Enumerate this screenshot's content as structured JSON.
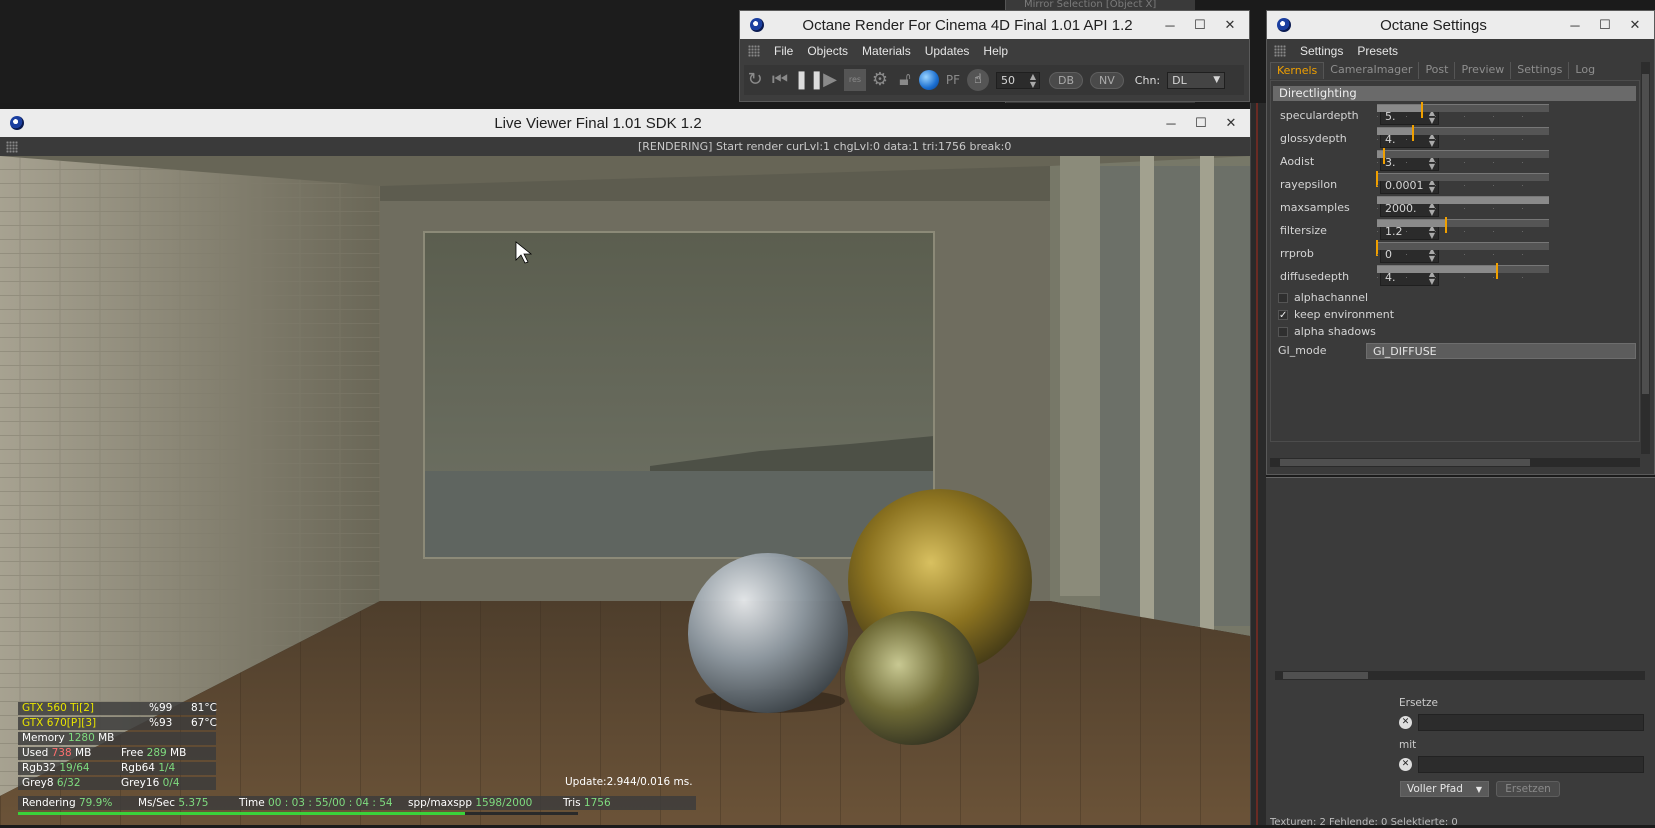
{
  "octane_window": {
    "title": "Octane Render For Cinema 4D Final 1.01   API 1.2",
    "menu": [
      "File",
      "Objects",
      "Materials",
      "Updates",
      "Help"
    ],
    "toolbar": {
      "value": "50",
      "db": "DB",
      "nv": "NV",
      "chn_label": "Chn:",
      "chn_value": "DL"
    }
  },
  "background_window": {
    "partial_title": "Mirror Selection [Object X]"
  },
  "settings_window": {
    "title": "Octane Settings",
    "menu": [
      "Settings",
      "Presets"
    ],
    "tabs": [
      "Kernels",
      "CameraImager",
      "Post",
      "Preview",
      "Settings",
      "Log"
    ],
    "section": "Directlighting",
    "params": [
      {
        "label": "speculardepth",
        "value": "5.",
        "fill": 0.26,
        "marker": 0.26
      },
      {
        "label": "glossydepth",
        "value": "4.",
        "fill": 0.21,
        "marker": 0.21
      },
      {
        "label": "Aodist",
        "value": "3.",
        "fill": 0.04,
        "marker": 0.04
      },
      {
        "label": "rayepsilon",
        "value": "0.0001",
        "fill": 0.0,
        "marker": 0.0
      },
      {
        "label": "maxsamples",
        "value": "2000.",
        "fill": 1.0,
        "marker": null
      },
      {
        "label": "filtersize",
        "value": "1.2",
        "fill": 0.4,
        "marker": 0.4
      },
      {
        "label": "rrprob",
        "value": "0",
        "fill": 0.0,
        "marker": 0.0
      },
      {
        "label": "diffusedepth",
        "value": "4.",
        "fill": 0.7,
        "marker": 0.7
      }
    ],
    "checkboxes": [
      {
        "label": "alphachannel",
        "checked": false
      },
      {
        "label": "keep environment",
        "checked": true
      },
      {
        "label": "alpha shadows",
        "checked": false
      }
    ],
    "gi_mode_label": "GI_mode",
    "gi_mode_value": "GI_DIFFUSE"
  },
  "replace_panel": {
    "ersetze": "Ersetze",
    "mit": "mit",
    "path_option": "Voller Pfad",
    "replace_button": "Ersetzen",
    "status": "Texturen: 2   Fehlende: 0   Selektierte: 0"
  },
  "live_viewer": {
    "title": "Live Viewer Final 1.01   SDK 1.2",
    "status": "[RENDERING] Start render curLvl:1 chgLvl:0 data:1 tri:1756 break:0",
    "update": "Update:2.944/0.016 ms.",
    "hud": {
      "gpu1": "GTX 560 Ti[2]",
      "gpu1_load": "%99",
      "gpu1_temp": "81°C",
      "gpu2": "GTX 670[P][3]",
      "gpu2_load": "%93",
      "gpu2_temp": "67°C",
      "memory_label": "Memory",
      "memory_val": "1280",
      "memory_unit": "MB",
      "used_label": "Used",
      "used_val": "738",
      "used_unit": "MB",
      "free_label": "Free",
      "free_val": "289",
      "free_unit": "MB",
      "rgb32_label": "Rgb32",
      "rgb32_val": "19/64",
      "rgb64_label": "Rgb64",
      "rgb64_val": "1/4",
      "grey8_label": "Grey8",
      "grey8_val": "6/32",
      "grey16_label": "Grey16",
      "grey16_val": "0/4",
      "rendering_label": "Rendering",
      "rendering_val": "79.9%",
      "mssec_label": "Ms/Sec",
      "mssec_val": "5.375",
      "time_label": "Time",
      "time_val": "00 : 03 : 55/00 : 04 : 54",
      "spp_label": "spp/maxspp",
      "spp_val": "1598/2000",
      "tris_label": "Tris",
      "tris_val": "1756",
      "progress": 0.799
    }
  },
  "colors": {
    "accent": "#f0a000",
    "hud_yellow": "#e8e400",
    "hud_green": "#7fdc7f",
    "hud_red": "#ff6f6f"
  }
}
